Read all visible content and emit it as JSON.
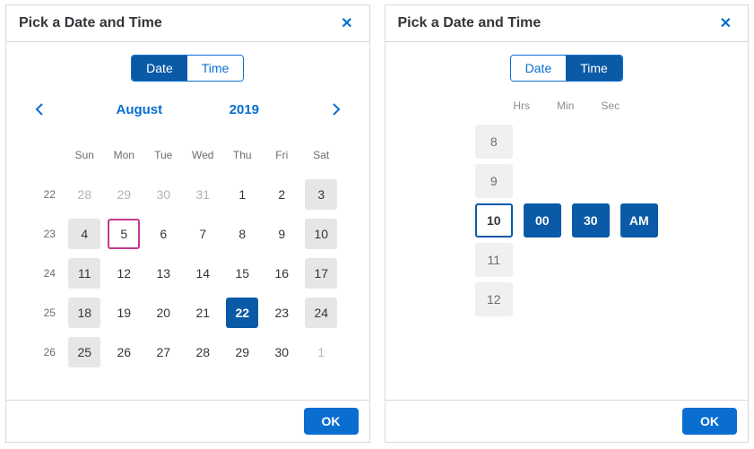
{
  "left": {
    "title": "Pick a Date and Time",
    "tabs": {
      "date": "Date",
      "time": "Time",
      "active": "date"
    },
    "month": "August",
    "year": "2019",
    "weekdays": [
      "Sun",
      "Mon",
      "Tue",
      "Wed",
      "Thu",
      "Fri",
      "Sat"
    ],
    "weeks": [
      {
        "no": "22",
        "days": [
          {
            "d": "28",
            "cls": "out"
          },
          {
            "d": "29",
            "cls": "out"
          },
          {
            "d": "30",
            "cls": "out"
          },
          {
            "d": "31",
            "cls": "out"
          },
          {
            "d": "1",
            "cls": ""
          },
          {
            "d": "2",
            "cls": ""
          },
          {
            "d": "3",
            "cls": "shade"
          }
        ]
      },
      {
        "no": "23",
        "days": [
          {
            "d": "4",
            "cls": "shade"
          },
          {
            "d": "5",
            "cls": "today"
          },
          {
            "d": "6",
            "cls": ""
          },
          {
            "d": "7",
            "cls": ""
          },
          {
            "d": "8",
            "cls": ""
          },
          {
            "d": "9",
            "cls": ""
          },
          {
            "d": "10",
            "cls": "shade"
          }
        ]
      },
      {
        "no": "24",
        "days": [
          {
            "d": "11",
            "cls": "shade"
          },
          {
            "d": "12",
            "cls": ""
          },
          {
            "d": "13",
            "cls": ""
          },
          {
            "d": "14",
            "cls": ""
          },
          {
            "d": "15",
            "cls": ""
          },
          {
            "d": "16",
            "cls": ""
          },
          {
            "d": "17",
            "cls": "shade"
          }
        ]
      },
      {
        "no": "25",
        "days": [
          {
            "d": "18",
            "cls": "shade"
          },
          {
            "d": "19",
            "cls": ""
          },
          {
            "d": "20",
            "cls": ""
          },
          {
            "d": "21",
            "cls": ""
          },
          {
            "d": "22",
            "cls": "selected"
          },
          {
            "d": "23",
            "cls": ""
          },
          {
            "d": "24",
            "cls": "shade"
          }
        ]
      },
      {
        "no": "26",
        "days": [
          {
            "d": "25",
            "cls": "shade"
          },
          {
            "d": "26",
            "cls": ""
          },
          {
            "d": "27",
            "cls": ""
          },
          {
            "d": "28",
            "cls": ""
          },
          {
            "d": "29",
            "cls": ""
          },
          {
            "d": "30",
            "cls": ""
          },
          {
            "d": "1",
            "cls": "out"
          }
        ]
      }
    ],
    "ok": "OK"
  },
  "right": {
    "title": "Pick a Date and Time",
    "tabs": {
      "date": "Date",
      "time": "Time",
      "active": "time"
    },
    "labels": {
      "hrs": "Hrs",
      "min": "Min",
      "sec": "Sec"
    },
    "hours": [
      "8",
      "9",
      "10",
      "11",
      "12"
    ],
    "selHourIndex": 2,
    "min": "00",
    "sec": "30",
    "ampm": "AM",
    "ok": "OK"
  }
}
